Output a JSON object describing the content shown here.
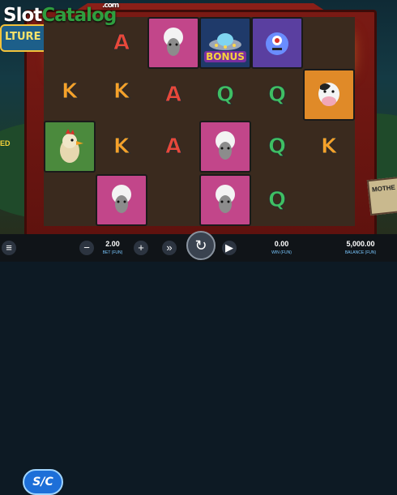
{
  "watermark": {
    "slot": "Slot",
    "catalog": "Catalog",
    "dotcom": ".com"
  },
  "logo": {
    "text": "LTURE"
  },
  "left_partial_text": "ED",
  "sign": {
    "text": "MOTHE"
  },
  "reels": [
    [
      "K",
      "rooster",
      "sheep"
    ],
    [
      "A",
      "K",
      "sheep"
    ],
    [
      "sheep",
      "A",
      "Q"
    ],
    [
      "bonus",
      "Q",
      "sheep"
    ],
    [
      "alien",
      "Q",
      "Q"
    ],
    [
      "cow",
      "K",
      ""
    ]
  ],
  "bonus_label": "BONUS",
  "controls": {
    "bet_value": "2.00",
    "bet_label": "BET (FUN)",
    "win_value": "0.00",
    "win_label": "WIN (FUN)",
    "balance_value": "5,000.00",
    "balance_label": "BALANCE (FUN)",
    "minus_symbol": "−",
    "plus_symbol": "+",
    "turbo_symbol": "»",
    "spin_symbol": "↻",
    "autoplay_symbol": "▶",
    "sc_label": "S/C",
    "menu_symbol": "≡"
  },
  "colors": {
    "accent": "#1d6fd8",
    "barn": "#7a1a14"
  }
}
